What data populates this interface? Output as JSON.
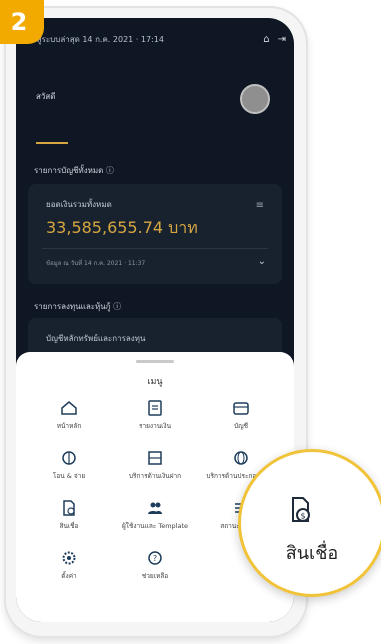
{
  "step_badge": "2",
  "status": {
    "text": "เข้าสู่ระบบล่าสุด 14 ก.ค. 2021 · 17:14"
  },
  "user": {
    "name": "สวัสดี"
  },
  "accounts_section": {
    "title": "รายการบัญชีทั้งหมด ⓘ"
  },
  "balance_card": {
    "label": "ยอดเงินรวมทั้งหมด",
    "amount": "33,585,655.74 บาท",
    "updated": "ข้อมูล ณ วันที่ 14 ก.ค. 2021 · 11:37"
  },
  "investment_section": {
    "title": "รายการลงทุนและหุ้นกู้ ⓘ"
  },
  "investment_card": {
    "label": "บัญชีหลักทรัพย์และการลงทุน"
  },
  "menu": {
    "title": "เมนู",
    "items": [
      {
        "icon": "home-icon",
        "label": "หน้าหลัก"
      },
      {
        "icon": "document-icon",
        "label": "รายงานเงิน"
      },
      {
        "icon": "wallet-icon",
        "label": "บัญชี"
      },
      {
        "icon": "transfer-icon",
        "label": "โอน & จ่าย"
      },
      {
        "icon": "exchange-icon",
        "label": "บริการด้านเงินฝาก"
      },
      {
        "icon": "globe-icon",
        "label": "บริการด้านประกอบธุรกิจ"
      },
      {
        "icon": "loan-icon",
        "label": "สินเชื่อ"
      },
      {
        "icon": "users-icon",
        "label": "ผู้ใช้งานและ Template"
      },
      {
        "icon": "list-icon",
        "label": "สถานะรายการ"
      },
      {
        "icon": "settings-icon",
        "label": "ตั้งค่า"
      },
      {
        "icon": "help-icon",
        "label": "ช่วยเหลือ"
      }
    ]
  },
  "zoom_callout": {
    "icon": "loan-icon",
    "label": "สินเชื่อ"
  },
  "colors": {
    "accent": "#f2a900",
    "gold": "#d6a740",
    "dark_bg": "#0f1724"
  }
}
